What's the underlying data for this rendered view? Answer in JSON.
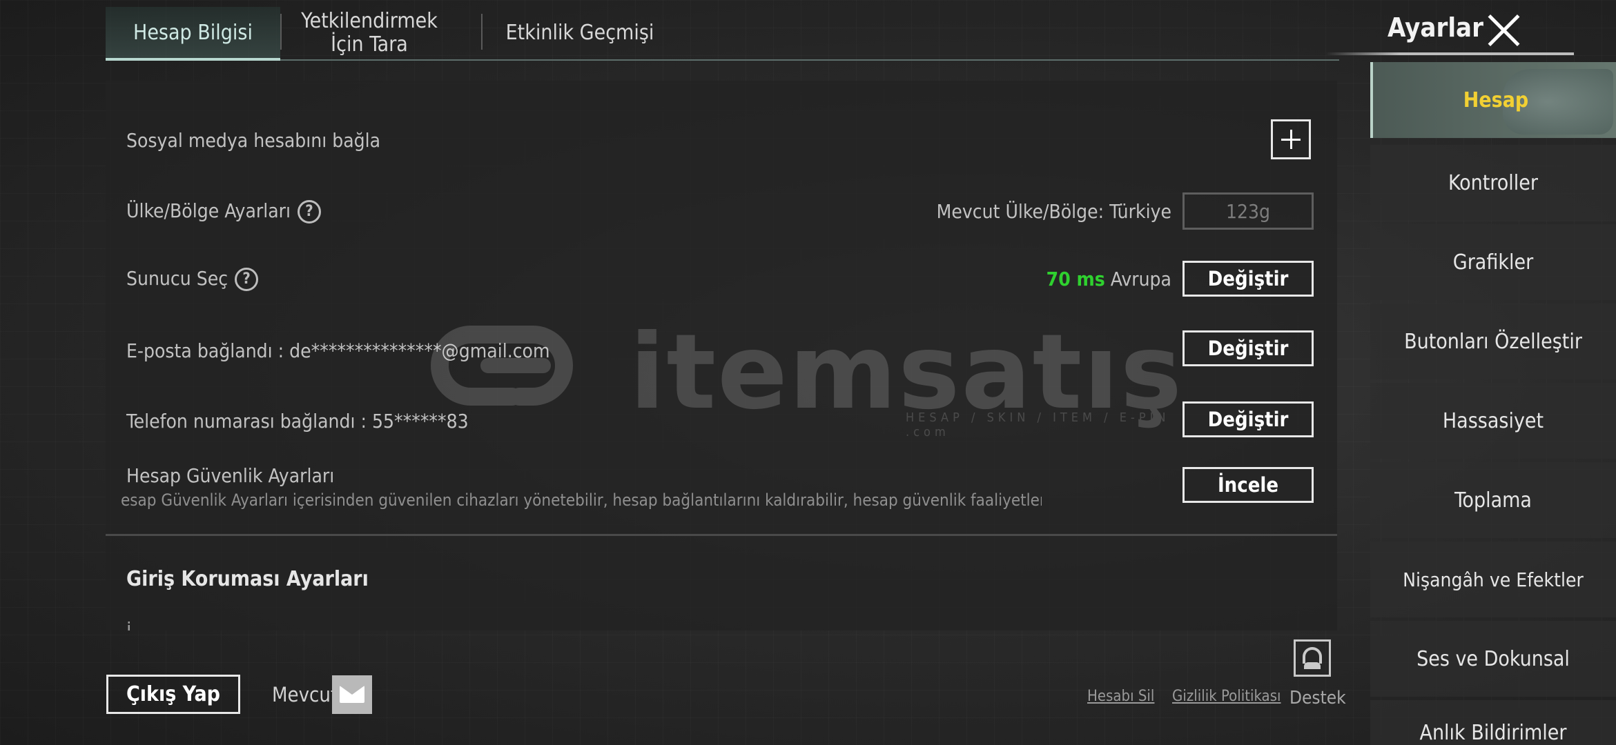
{
  "header": {
    "tabs": [
      {
        "label": "Hesap Bilgisi",
        "active": true
      },
      {
        "label": "Yetkilendirmek İçin Tara",
        "active": false
      },
      {
        "label": "Etkinlik Geçmişi",
        "active": false
      }
    ],
    "title": "Ayarlar"
  },
  "account": {
    "social_link_label": "Sosyal medya hesabını bağla",
    "region_label": "Ülke/Bölge Ayarları",
    "region_current": "Mevcut Ülke/Bölge: Türkiye",
    "region_box_value": "123g",
    "server_label": "Sunucu Seç",
    "server_ping": "70 ms",
    "server_name": "Avrupa",
    "server_button": "Değiştir",
    "email_label": "E-posta bağlandı : de***************@gmail.com",
    "email_button": "Değiştir",
    "phone_label": "Telefon numarası bağlandı : 55******83",
    "phone_button": "Değiştir",
    "security_label": "Hesap Güvenlik Ayarları",
    "security_desc": "esap Güvenlik Ayarları içerisinden güvenilen cihazları yönetebilir, hesap bağlantılarını kaldırabilir, hesap güvenlik faaliyetlerini kontrol ede",
    "security_button": "İncele",
    "login_protection_title": "Giriş Koruması Ayarları"
  },
  "watermark": {
    "brand": "itemsatış",
    "tagline": "HESAP / SKIN / ITEM / E-PIN",
    "suffix": ".com"
  },
  "sidebar": {
    "items": [
      {
        "label": "Hesap",
        "active": true
      },
      {
        "label": "Kontroller"
      },
      {
        "label": "Grafikler"
      },
      {
        "label": "Butonları Özelleştir"
      },
      {
        "label": "Hassasiyet"
      },
      {
        "label": "Toplama"
      },
      {
        "label": "Nişangâh ve Efektler"
      },
      {
        "label": "Ses ve Dokunsal"
      },
      {
        "label": "Anlık Bildirimler"
      }
    ]
  },
  "footer": {
    "logout_label": "Çıkış Yap",
    "mail_label": "Mevcut",
    "delete_account": "Hesabı Sil",
    "privacy_policy": "Gizlilik Politikası",
    "support": "Destek"
  },
  "colors": {
    "ping_green": "#2fd12f",
    "active_side_text": "#f2d033",
    "active_tab_text": "#cfe9e4"
  }
}
